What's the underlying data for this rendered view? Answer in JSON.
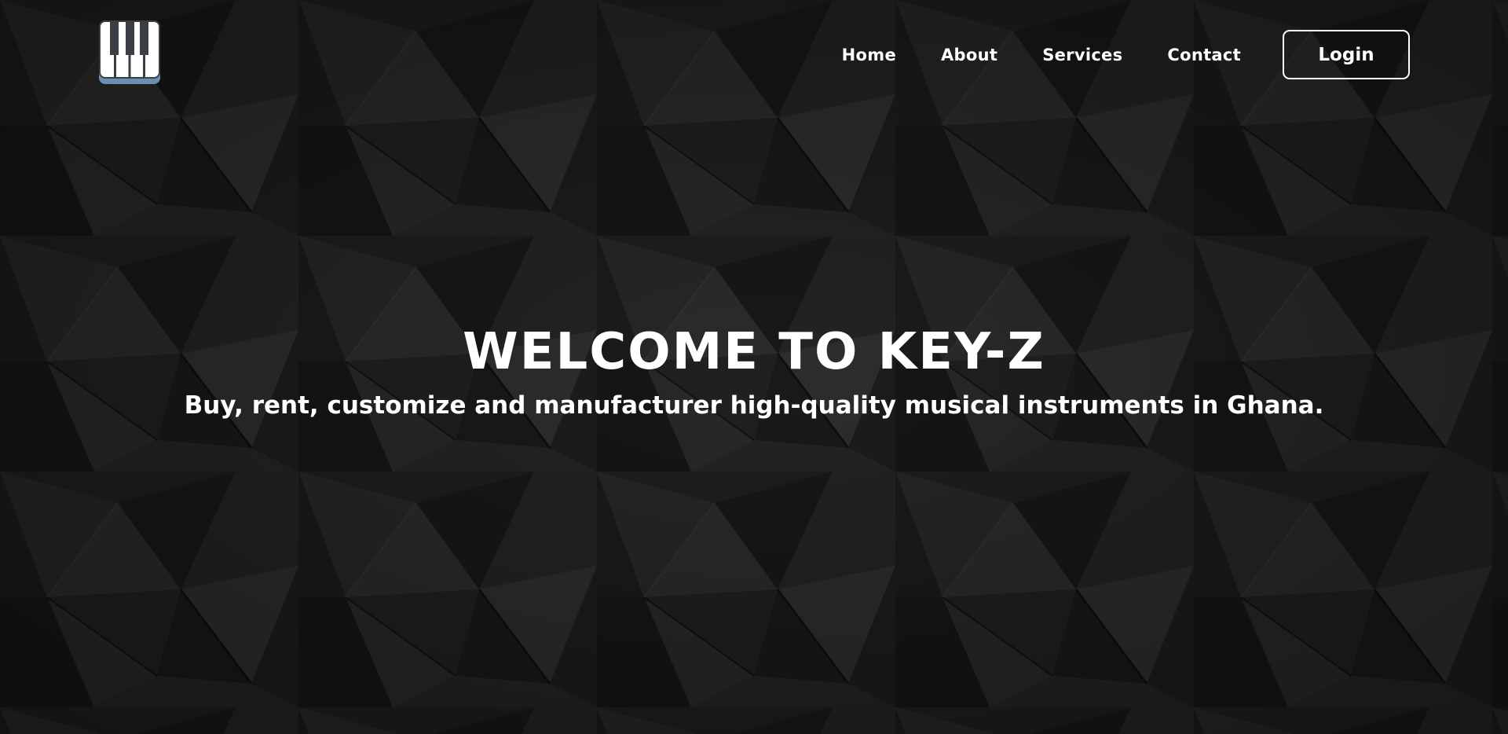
{
  "colors": {
    "background": "#222222",
    "text": "#ffffff",
    "logo_accent": "#6a8fb3"
  },
  "header": {
    "logo_icon": "piano-keys-icon",
    "nav": [
      {
        "label": "Home"
      },
      {
        "label": "About"
      },
      {
        "label": "Services"
      },
      {
        "label": "Contact"
      }
    ],
    "login_label": "Login"
  },
  "hero": {
    "title": "WELCOME TO KEY-Z",
    "subtitle": "Buy, rent, customize and manufacturer high-quality musical instruments in Ghana."
  }
}
